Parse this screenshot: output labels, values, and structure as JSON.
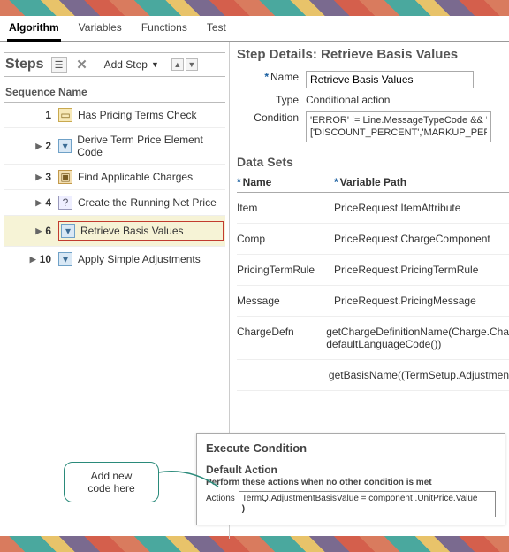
{
  "tabs": {
    "items": [
      "Algorithm",
      "Variables",
      "Functions",
      "Test"
    ],
    "active": 0
  },
  "steps_panel": {
    "title": "Steps",
    "add_label": "Add Step",
    "col_seq": "Sequence",
    "col_name": "Name",
    "rows": [
      {
        "seq": "1",
        "name": "Has Pricing Terms Check",
        "icon": "doc",
        "expandable": false
      },
      {
        "seq": "2",
        "name": "Derive Term Price Element Code",
        "icon": "funnel",
        "expandable": true
      },
      {
        "seq": "3",
        "name": "Find Applicable Charges",
        "icon": "bag",
        "expandable": true
      },
      {
        "seq": "4",
        "name": "Create the Running Net Price",
        "icon": "q",
        "expandable": true
      },
      {
        "seq": "6",
        "name": "Retrieve Basis Values",
        "icon": "funnel",
        "expandable": true,
        "selected": true
      },
      {
        "seq": "10",
        "name": "Apply Simple Adjustments",
        "icon": "funnel",
        "expandable": true
      }
    ]
  },
  "details": {
    "heading": "Step Details: Retrieve Basis Values",
    "name_lbl": "Name",
    "name_val": "Retrieve Basis Values",
    "type_lbl": "Type",
    "type_val": "Conditional action",
    "cond_lbl": "Condition",
    "cond_line1": "'ERROR' != Line.MessageTypeCode && 'SIMP",
    "cond_line2": "['DISCOUNT_PERCENT','MARKUP_PERCEN"
  },
  "datasets": {
    "heading": "Data Sets",
    "col_name": "Name",
    "col_var": "Variable Path",
    "rows": [
      {
        "n": "Item",
        "v": "PriceRequest.ItemAttribute"
      },
      {
        "n": "Comp",
        "v": "PriceRequest.ChargeComponent"
      },
      {
        "n": "PricingTermRule",
        "v": "PriceRequest.PricingTermRule"
      },
      {
        "n": "Message",
        "v": "PriceRequest.PricingMessage"
      },
      {
        "n": "ChargeDefn",
        "v": "getChargeDefinitionName(Charge.Cha\ndefaultLanguageCode())"
      },
      {
        "n": "",
        "v": "getBasisName((TermSetup.Adjustmen"
      }
    ]
  },
  "exec": {
    "heading": "Execute Condition",
    "default_h": "Default Action",
    "default_sub": "Perform these actions when no other condition is met",
    "actions_lbl": "Actions",
    "action_line1": "TermQ.AdjustmentBasisValue = component .UnitPrice.Value",
    "action_line2": ")"
  },
  "callout": {
    "line1": "Add new",
    "line2": "code here"
  }
}
